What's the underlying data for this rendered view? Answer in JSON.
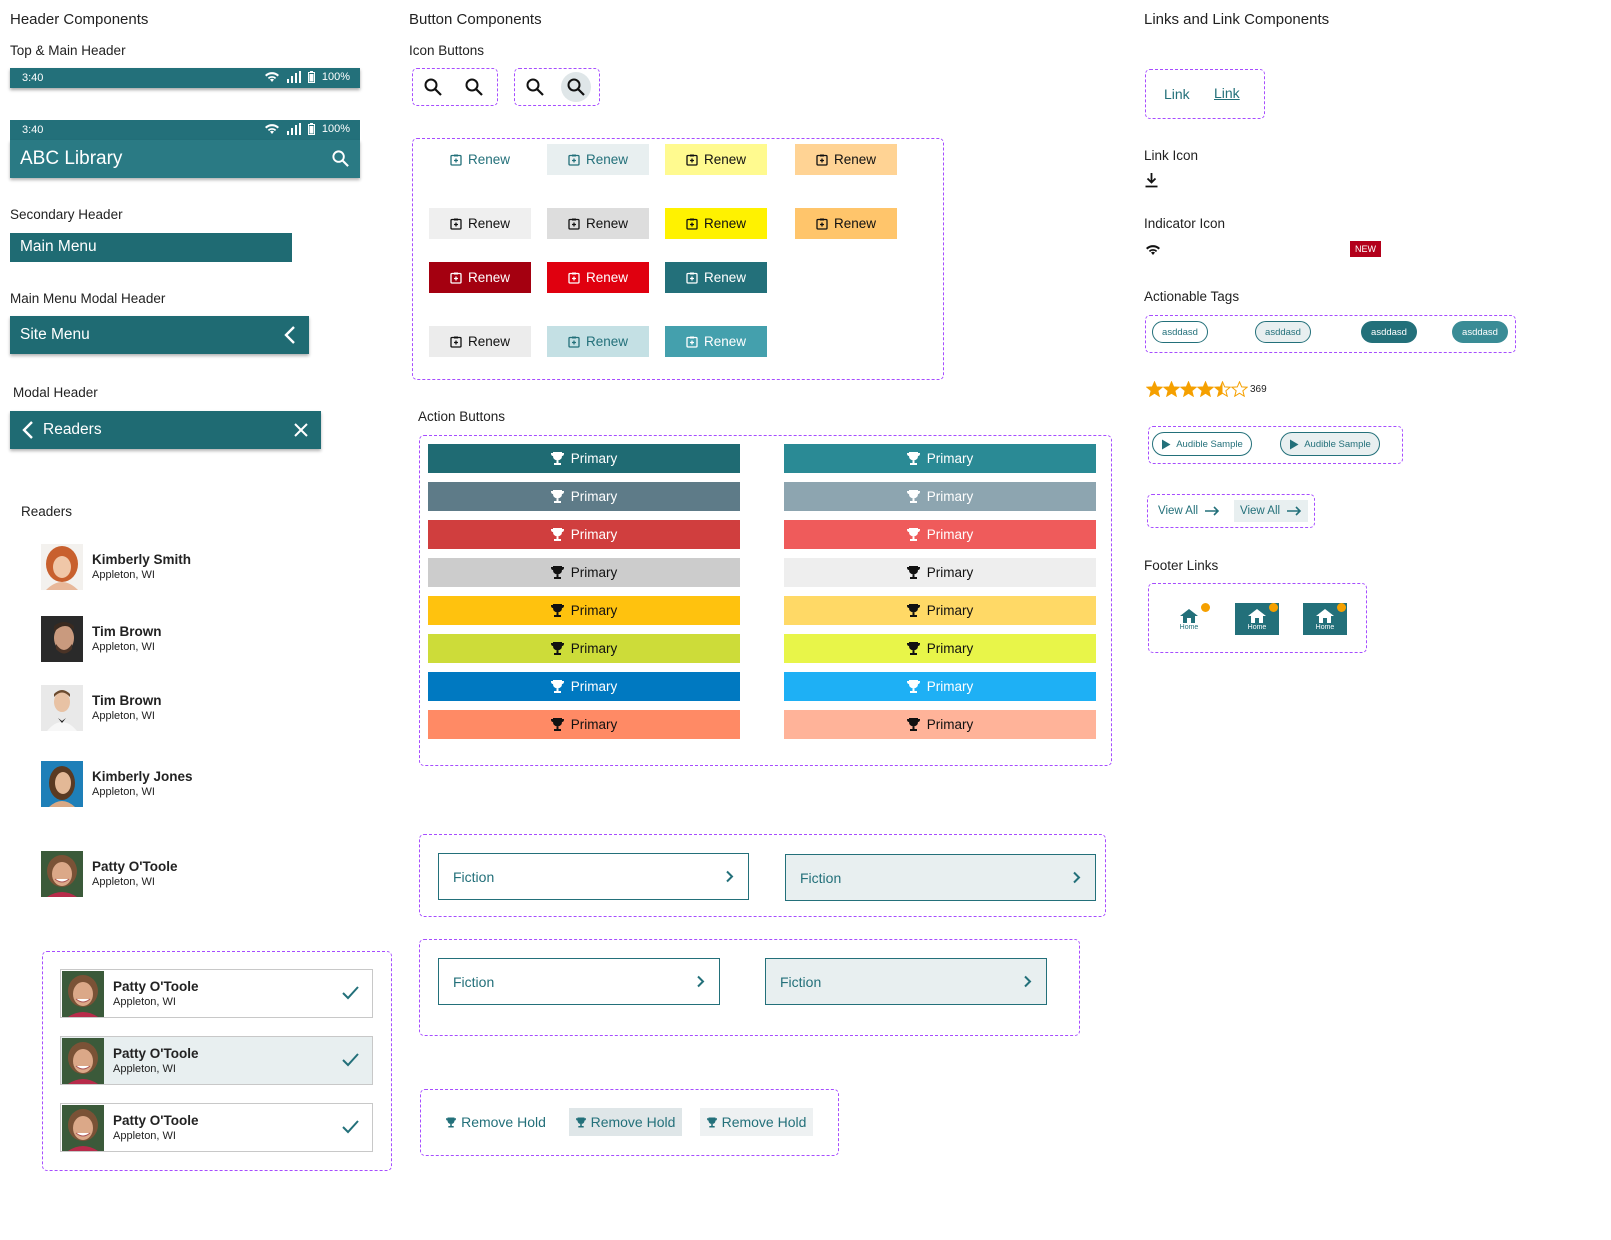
{
  "sections": {
    "header": "Header Components",
    "buttons": "Button Components",
    "links": "Links and Link Components"
  },
  "labels": {
    "top_main": "Top & Main Header",
    "secondary": "Secondary Header",
    "main_menu_modal": "Main Menu Modal Header",
    "modal": "Modal Header",
    "readers": "Readers",
    "icon_buttons": "Icon Buttons",
    "action_buttons": "Action Buttons",
    "link_icon": "Link Icon",
    "indicator_icon": "Indicator Icon",
    "actionable_tags": "Actionable Tags",
    "footer_links": "Footer Links"
  },
  "status_bar": {
    "time": "3:40",
    "battery": "100%"
  },
  "main_header": {
    "title": "ABC Library"
  },
  "secondary_header": {
    "title": "Main Menu"
  },
  "site_menu_header": {
    "title": "Site Menu"
  },
  "modal_header": {
    "title": "Readers"
  },
  "readers": [
    {
      "name": "Kimberly Smith",
      "city": "Appleton, WI"
    },
    {
      "name": "Tim Brown",
      "city": "Appleton, WI"
    },
    {
      "name": "Tim Brown",
      "city": "Appleton, WI"
    },
    {
      "name": "Kimberly Jones",
      "city": "Appleton, WI"
    },
    {
      "name": "Patty O'Toole",
      "city": "Appleton, WI"
    }
  ],
  "selected_readers": [
    {
      "name": "Patty O'Toole",
      "city": "Appleton, WI"
    },
    {
      "name": "Patty O'Toole",
      "city": "Appleton, WI"
    },
    {
      "name": "Patty O'Toole",
      "city": "Appleton, WI"
    }
  ],
  "renew_label": "Renew",
  "primary_label": "Primary",
  "fiction_label": "Fiction",
  "remove_hold_label": "Remove Hold",
  "links": {
    "link": "Link",
    "new_badge": "NEW",
    "view_all": "View All",
    "audible": "Audible Sample",
    "home": "Home"
  },
  "tags": [
    "asddasd",
    "asddasd",
    "asddasd",
    "asddasd"
  ],
  "rating": {
    "count": "369",
    "value": 4.5,
    "max": 6
  },
  "colors": {
    "teal": "#23707a",
    "teal_dark": "#1f6b73"
  }
}
